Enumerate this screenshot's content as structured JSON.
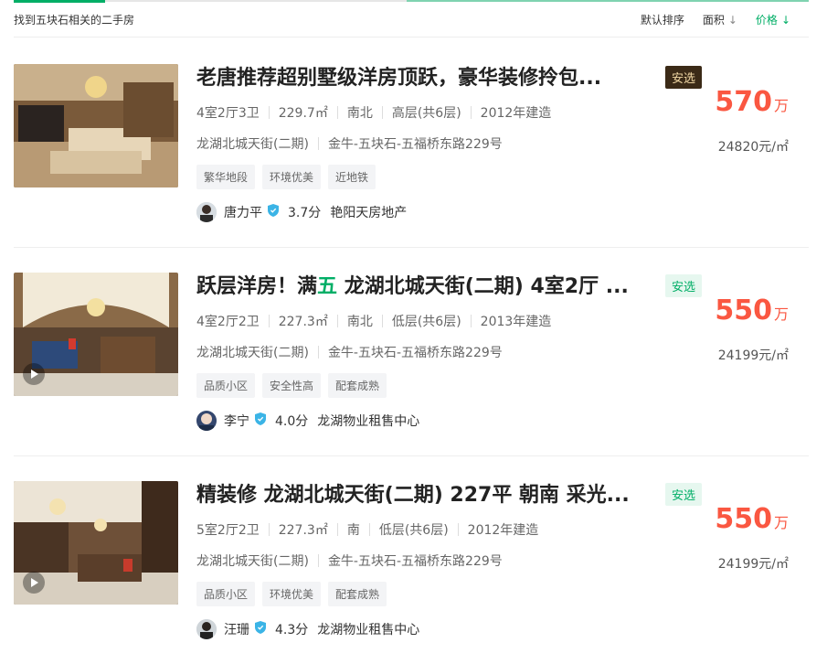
{
  "header": {
    "found_text": "找到五块石相关的二手房",
    "sorts": [
      {
        "label": "默认排序",
        "arrow": ""
      },
      {
        "label": "面积",
        "arrow": "↓"
      },
      {
        "label": "价格",
        "arrow": "↓"
      }
    ]
  },
  "listings": [
    {
      "title": "老唐推荐超别墅级洋房顶跃，豪华装修拎包...",
      "badge": "安选",
      "rooms": "4室2厅3卫",
      "area": "229.7㎡",
      "orientation": "南北",
      "floor": "高层(共6层)",
      "year": "2012年建造",
      "community": "龙湖北城天街(二期)",
      "location": "金牛-五块石-五福桥东路229号",
      "tags": [
        "繁华地段",
        "环境优美",
        "近地铁"
      ],
      "agent": "唐力平",
      "score": "3.7分",
      "agency": "艳阳天房地产",
      "price": "570",
      "price_unit": "万",
      "unit_price": "24820元/㎡"
    },
    {
      "title_pre": "跃层洋房！满",
      "title_hl": "五",
      "title_post": " 龙湖北城天街(二期) 4室2厅 ...",
      "badge": "安选",
      "rooms": "4室2厅2卫",
      "area": "227.3㎡",
      "orientation": "南北",
      "floor": "低层(共6层)",
      "year": "2013年建造",
      "community": "龙湖北城天街(二期)",
      "location": "金牛-五块石-五福桥东路229号",
      "tags": [
        "品质小区",
        "安全性高",
        "配套成熟"
      ],
      "agent": "李宁",
      "score": "4.0分",
      "agency": "龙湖物业租售中心",
      "price": "550",
      "price_unit": "万",
      "unit_price": "24199元/㎡"
    },
    {
      "title": "精装修 龙湖北城天街(二期) 227平 朝南 采光...",
      "badge": "安选",
      "rooms": "5室2厅2卫",
      "area": "227.3㎡",
      "orientation": "南",
      "floor": "低层(共6层)",
      "year": "2012年建造",
      "community": "龙湖北城天街(二期)",
      "location": "金牛-五块石-五福桥东路229号",
      "tags": [
        "品质小区",
        "环境优美",
        "配套成熟"
      ],
      "agent": "汪珊",
      "score": "4.3分",
      "agency": "龙湖物业租售中心",
      "price": "550",
      "price_unit": "万",
      "unit_price": "24199元/㎡"
    }
  ]
}
